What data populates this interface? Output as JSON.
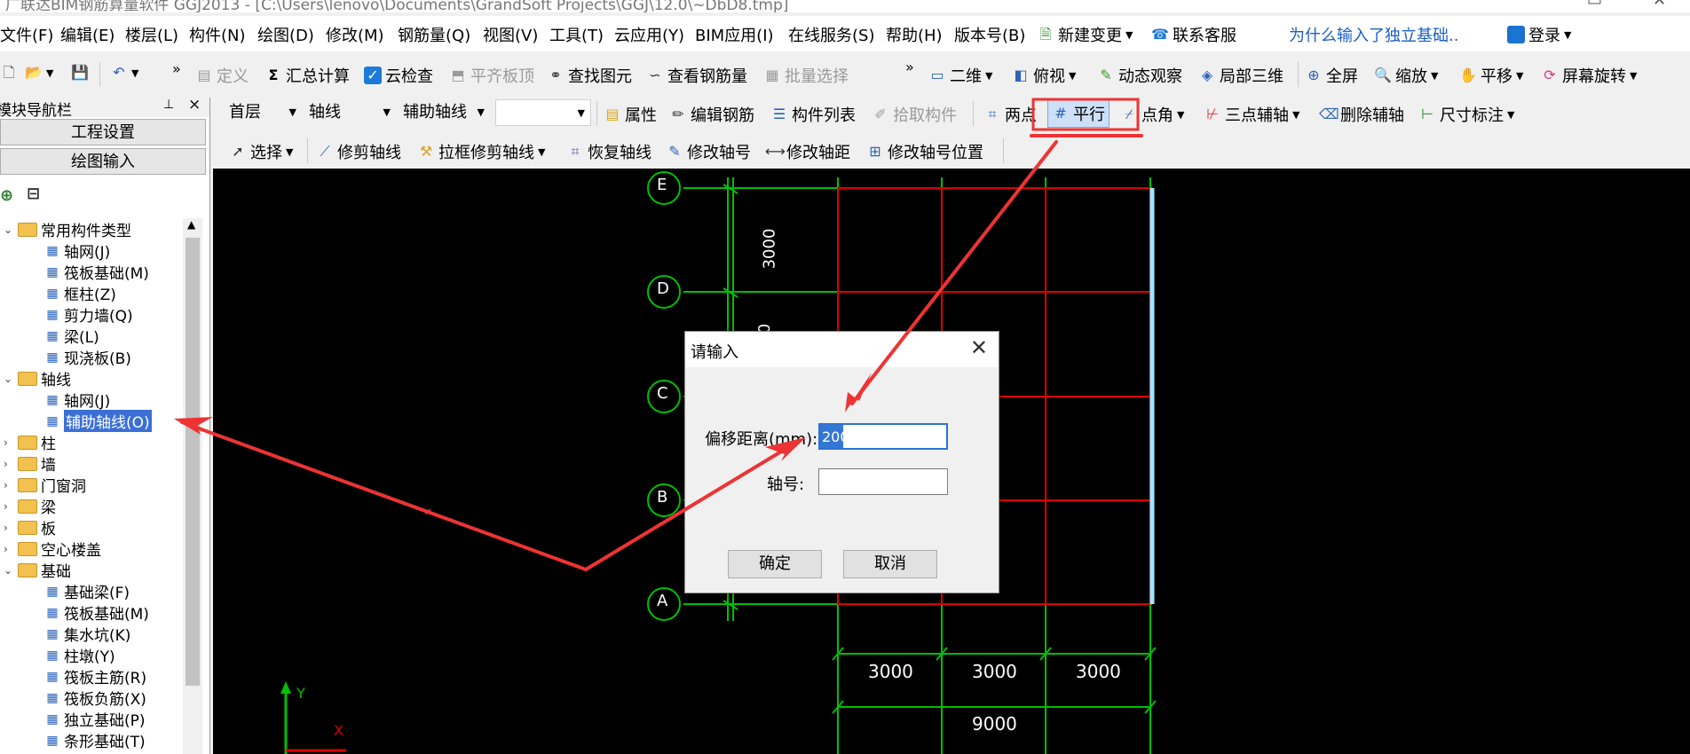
{
  "title_bar": {
    "text": "广联达BIM钢筋算量软件 GGJ2013 - [C:\\Users\\lenovo\\Documents\\GrandSoft Projects\\GGJ\\12.0\\~DbD8.tmp]"
  },
  "menu": {
    "items": [
      "文件(F)",
      "编辑(E)",
      "楼层(L)",
      "构件(N)",
      "绘图(D)",
      "修改(M)",
      "钢筋量(Q)",
      "视图(V)",
      "工具(T)",
      "云应用(Y)",
      "BIM应用(I)",
      "在线服务(S)",
      "帮助(H)",
      "版本号(B)"
    ],
    "new_change": "新建变更",
    "contact": "联系客服",
    "question": "为什么输入了独立基础..",
    "login": "登录"
  },
  "toolbar1": {
    "define": "定义",
    "summary": "汇总计算",
    "cloud_check": "云检查",
    "flat_board_top": "平齐板顶",
    "find_element": "查找图元",
    "view_rebar": "查看钢筋量",
    "batch_select": "批量选择",
    "view_2d": "二维",
    "top_view": "俯视",
    "dynamic_view": "动态观察",
    "local_3d": "局部三维",
    "full_screen": "全屏",
    "zoom": "缩放",
    "pan": "平移",
    "rotate_screen": "屏幕旋转"
  },
  "toolbar2": {
    "floor": "首层",
    "category": "轴线",
    "component": "辅助轴线",
    "blank": "",
    "properties": "属性",
    "edit_rebar": "编辑钢筋",
    "component_list": "构件列表",
    "pick_component": "拾取构件",
    "two_point": "两点",
    "parallel": "平行",
    "point_angle": "点角",
    "three_point_aux": "三点辅轴",
    "delete_aux": "删除辅轴",
    "dimension": "尺寸标注"
  },
  "toolbar3": {
    "select": "选择",
    "trim_axis": "修剪轴线",
    "box_trim_axis": "拉框修剪轴线",
    "restore_axis": "恢复轴线",
    "modify_axis_no": "修改轴号",
    "modify_axis_dist": "修改轴距",
    "modify_axis_pos": "修改轴号位置"
  },
  "sidebar": {
    "header": "模块导航栏",
    "pin": "ᅮ",
    "close": "×",
    "project_settings": "工程设置",
    "drawing_input": "绘图输入",
    "tree": [
      {
        "label": "常用构件类型",
        "type": "folder",
        "expanded": true
      },
      {
        "label": "轴网(J)",
        "type": "leaf"
      },
      {
        "label": "筏板基础(M)",
        "type": "leaf"
      },
      {
        "label": "框柱(Z)",
        "type": "leaf"
      },
      {
        "label": "剪力墙(Q)",
        "type": "leaf"
      },
      {
        "label": "梁(L)",
        "type": "leaf"
      },
      {
        "label": "现浇板(B)",
        "type": "leaf"
      },
      {
        "label": "轴线",
        "type": "folder",
        "expanded": true
      },
      {
        "label": "轴网(J)",
        "type": "leaf"
      },
      {
        "label": "辅助轴线(O)",
        "type": "leaf",
        "selected": true
      },
      {
        "label": "柱",
        "type": "folder"
      },
      {
        "label": "墙",
        "type": "folder"
      },
      {
        "label": "门窗洞",
        "type": "folder"
      },
      {
        "label": "梁",
        "type": "folder"
      },
      {
        "label": "板",
        "type": "folder"
      },
      {
        "label": "空心楼盖",
        "type": "folder"
      },
      {
        "label": "基础",
        "type": "folder",
        "expanded": true
      },
      {
        "label": "基础梁(F)",
        "type": "leaf"
      },
      {
        "label": "筏板基础(M)",
        "type": "leaf"
      },
      {
        "label": "集水坑(K)",
        "type": "leaf"
      },
      {
        "label": "柱墩(Y)",
        "type": "leaf"
      },
      {
        "label": "筏板主筋(R)",
        "type": "leaf"
      },
      {
        "label": "筏板负筋(X)",
        "type": "leaf"
      },
      {
        "label": "独立基础(P)",
        "type": "leaf"
      },
      {
        "label": "条形基础(T)",
        "type": "leaf"
      }
    ]
  },
  "canvas": {
    "axis_labels": [
      "E",
      "D",
      "C",
      "B",
      "A"
    ],
    "vertical_dims": [
      "3000",
      "0"
    ],
    "horizontal_dims": [
      "3000",
      "3000",
      "3000"
    ],
    "total_dim": "9000",
    "ucs_y": "Y",
    "ucs_x": "X"
  },
  "dialog": {
    "title": "请输入",
    "offset_label": "偏移距离(mm):",
    "offset_value": "200",
    "axis_no_label": "轴号:",
    "axis_no_value": "",
    "ok": "确定",
    "cancel": "取消"
  },
  "colors": {
    "canvas_bg": "#000000",
    "grid_green": "#00c000",
    "axis_red": "#e00000",
    "annotation_red": "#ee3333",
    "highlight_cyan": "#9be8ff"
  }
}
